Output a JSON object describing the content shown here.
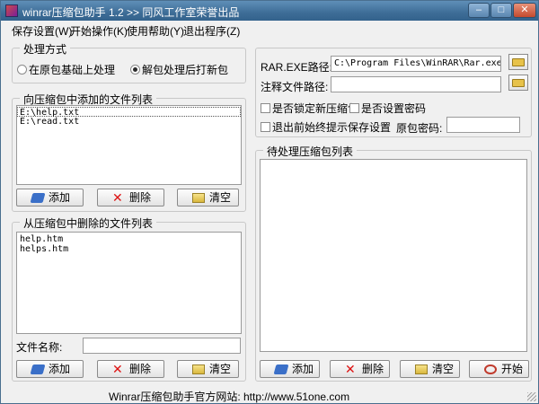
{
  "window": {
    "title": "winrar压缩包助手 1.2  >> 同风工作室荣誉出品"
  },
  "menu": [
    "保存设置(W)",
    "开始操作(K)",
    "使用帮助(Y)",
    "退出程序(Z)"
  ],
  "mode": {
    "legend": "处理方式",
    "option1": "在原包基础上处理",
    "option2": "解包处理后打新包",
    "selected": "option2"
  },
  "add_list": {
    "legend": "向压缩包中添加的文件列表",
    "items": [
      "E:\\help.txt",
      "E:\\read.txt"
    ],
    "buttons": {
      "add": "添加",
      "delete": "删除",
      "clear": "清空"
    }
  },
  "del_list": {
    "legend": "从压缩包中删除的文件列表",
    "items": [
      "help.htm",
      "helps.htm"
    ],
    "filename_label": "文件名称:",
    "filename_value": "",
    "buttons": {
      "add": "添加",
      "delete": "删除",
      "clear": "清空"
    }
  },
  "settings": {
    "rar_label": "RAR.EXE路径:",
    "rar_value": "C:\\Program Files\\WinRAR\\Rar.exe",
    "comment_label": "注释文件路径:",
    "comment_value": "",
    "lock_label": "是否锁定新压缩包",
    "password_label": "是否设置密码",
    "prompt_label": "退出前始终提示保存设置",
    "orig_pwd_label": "原包密码:",
    "orig_pwd_value": ""
  },
  "pending": {
    "legend": "待处理压缩包列表",
    "buttons": {
      "add": "添加",
      "delete": "删除",
      "clear": "清空",
      "start": "开始"
    }
  },
  "status": {
    "text": "Winrar压缩包助手官方网站: http://www.51one.com"
  }
}
